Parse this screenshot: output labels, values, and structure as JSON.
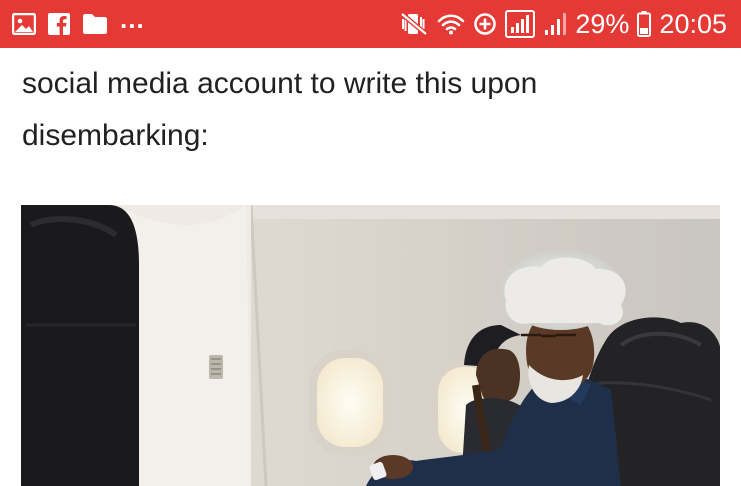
{
  "status_bar": {
    "left_icons": [
      "image-icon",
      "facebook-icon",
      "folder-icon"
    ],
    "overflow_indicator": "...",
    "right_icons": [
      "mute-vibrate-icon",
      "wifi-icon",
      "data-saver-icon",
      "signal-icon",
      "signal-icon"
    ],
    "battery_percent": "29%",
    "time": "20:05",
    "background_color": "#e53935"
  },
  "article": {
    "line1": "social media account to write this upon",
    "line2": "disembarking:"
  },
  "photo": {
    "subject": "airplane-cabin-photo"
  }
}
